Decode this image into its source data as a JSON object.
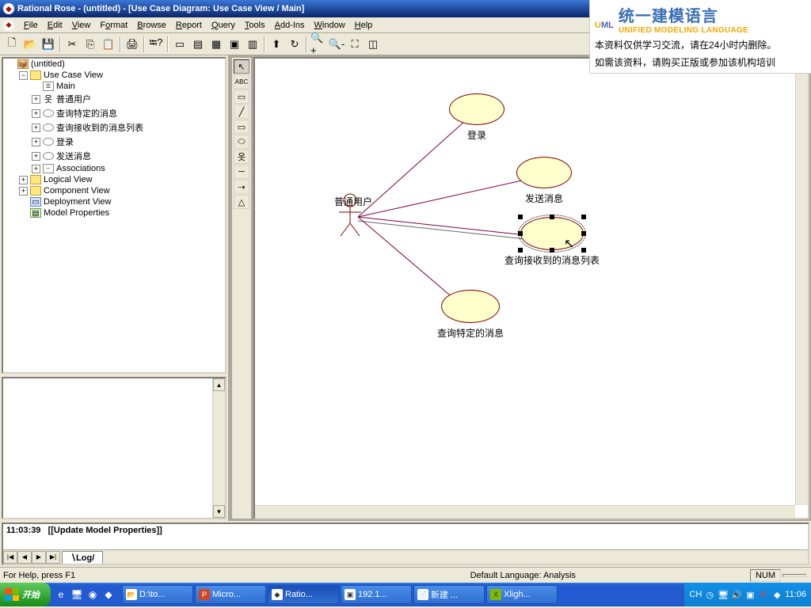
{
  "title": "Rational Rose - (untitled) - [Use Case Diagram: Use Case View / Main]",
  "menus": [
    "File",
    "Edit",
    "View",
    "Format",
    "Browse",
    "Report",
    "Query",
    "Tools",
    "Add-Ins",
    "Window",
    "Help"
  ],
  "tree": {
    "root": "(untitled)",
    "usecaseview": "Use Case View",
    "main": "Main",
    "items": [
      "普通用户",
      "查询特定的消息",
      "查询接收到的消息列表",
      "登录",
      "发送消息",
      "Associations"
    ],
    "logical": "Logical View",
    "component": "Component View",
    "deployment": "Deployment View",
    "modelprops": "Model Properties"
  },
  "diagram": {
    "actor": "普通用户",
    "uc1": "登录",
    "uc2": "发送消息",
    "uc3": "查询接收到的消息列表",
    "uc4": "查询特定的消息"
  },
  "log": {
    "time": "11:03:39",
    "msg": "[[Update Model Properties]]",
    "tab": "Log"
  },
  "status": {
    "help": "For Help, press F1",
    "lang": "Default Language: Analysis",
    "num": "NUM"
  },
  "taskbar": {
    "start": "开始",
    "tasks": [
      "D:\\to...",
      "Micro...",
      "Ratio...",
      "192.1...",
      "新建 ...",
      "Xligh..."
    ],
    "lang": "CH",
    "time": "11:06"
  },
  "watermark": {
    "cn": "统一建模语言",
    "en": "UNIFIED MODELING LANGUAGE",
    "note1": "本资料仅供学习交流，请在24小时内删除。",
    "note2": "如需该资料，请购买正版或参加该机构培训"
  }
}
